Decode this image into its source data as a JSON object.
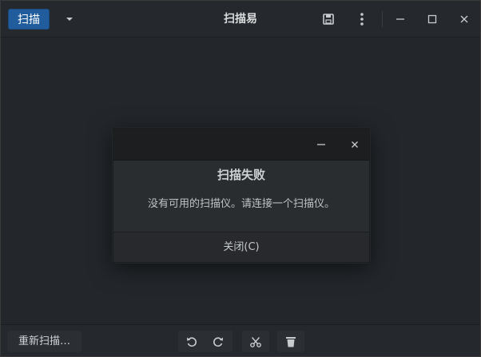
{
  "header": {
    "scan_label": "扫描",
    "title": "扫描易",
    "icons": {
      "dropdown": "chevron-down-icon",
      "save": "save-icon",
      "menu": "more-vertical-icon",
      "minimize": "minimize-icon",
      "maximize": "maximize-icon",
      "close": "close-icon"
    }
  },
  "dialog": {
    "heading": "扫描失败",
    "message": "没有可用的扫描仪。请连接一个扫描仪。",
    "close_label": "关闭(C)"
  },
  "bottombar": {
    "rescan_label": "重新扫描…",
    "icons": [
      "rotate-left-icon",
      "rotate-right-icon",
      "crop-icon",
      "delete-icon"
    ]
  },
  "colors": {
    "accent": "#215d9c",
    "window_bg": "#23272b",
    "dialog_bg": "#2a2d30",
    "text": "#d9dbdd"
  }
}
